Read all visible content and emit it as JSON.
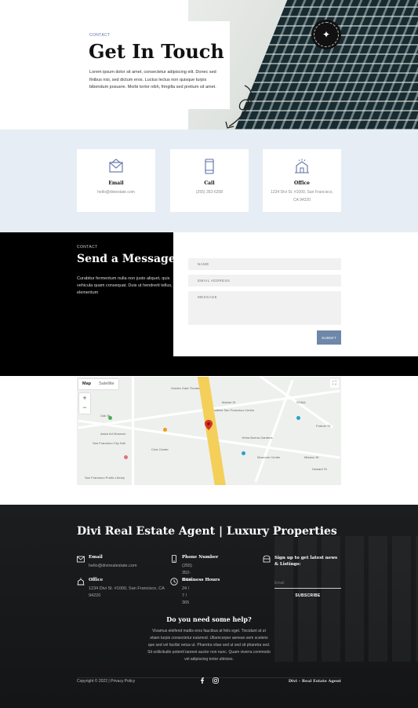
{
  "hero": {
    "eyebrow": "CONTACT",
    "title": "Get In Touch",
    "text": "Lorem ipsum dolor sit amet, consectetur adipiscing elit. Donec sed finibus nisi, sed dictum eros. Luctus lectus non quisque turpis bibendum posuere. Morbi tortor nibh, fringilla sed pretium sit amet."
  },
  "contact_cards": [
    {
      "label": "Email",
      "value": "hello@diviestate.com",
      "icon": "envelope-icon"
    },
    {
      "label": "Call",
      "value": "(255) 352-6258",
      "icon": "phone-icon"
    },
    {
      "label": "Office",
      "value": "1234 Divi St. #1000, San Francisco, CA 94220",
      "icon": "building-icon"
    }
  ],
  "message": {
    "eyebrow": "CONTACT",
    "title": "Send a Message",
    "text": "Curabitur fermentum nulla non justo aliquet, quis vehicula quam consequat. Duis ut hendrerit tellus, elementum",
    "name_placeholder": "NAME",
    "email_placeholder": "EMAIL ADDRESS",
    "message_placeholder": "MESSAGE",
    "submit_label": "SUBMIT"
  },
  "map": {
    "map_label": "Map",
    "satellite_label": "Satellite",
    "zoom_in": "+",
    "zoom_out": "−",
    "labels": [
      "Golden Gate Theatre",
      "Asian Art Museum",
      "San Francisco City Hall",
      "Westfield San Francisco Centre",
      "Yerba Buena Gardens",
      "San Francisco Public Library",
      "Civic Center",
      "Moscone Center",
      "Market St",
      "Mission St",
      "Howard St",
      "Folsom St",
      "SOMA",
      "Oak St"
    ]
  },
  "footer": {
    "title": "Divi Real Estate Agent | Luxury Properties",
    "email_label": "Email",
    "email_value": "hello@divirealestate.com",
    "phone_label": "Phone Number",
    "phone_value": "(255) 352-6258",
    "newsletter_label": "Sign up to get latest news & Listings:",
    "office_label": "Office",
    "office_value": "1234 Divi St. #1000, San Francisco, CA 94220",
    "hours_label": "Business Hours",
    "hours_value": "24 / 7 / 365",
    "newsletter_placeholder": "Email",
    "subscribe_label": "SUBSCRIBE",
    "help_title": "Do you need some help?",
    "help_text": "Vivamus eleifend mattis eros faucibus at felis eget. Tincidunt at ut etiam turpis consectetur euismod. Ullamcorper aenean sem sceleris que sed vel facilisi netus ut. Pharetra vitae sed ut sed sit pharetra sed. Sit sollicitudin potenti laoreet auctor non nunc. Quam viverra commodo vel adipiscing tortor ultricies.",
    "copyright": "Copyright © 2022 | Privacy Policy",
    "brand": "Divi – Real Estate Agent"
  },
  "colors": {
    "accent": "#5b6fa8",
    "band": "#e6edf4",
    "submit": "#6f87a8",
    "footer": "#1c1d1f"
  }
}
